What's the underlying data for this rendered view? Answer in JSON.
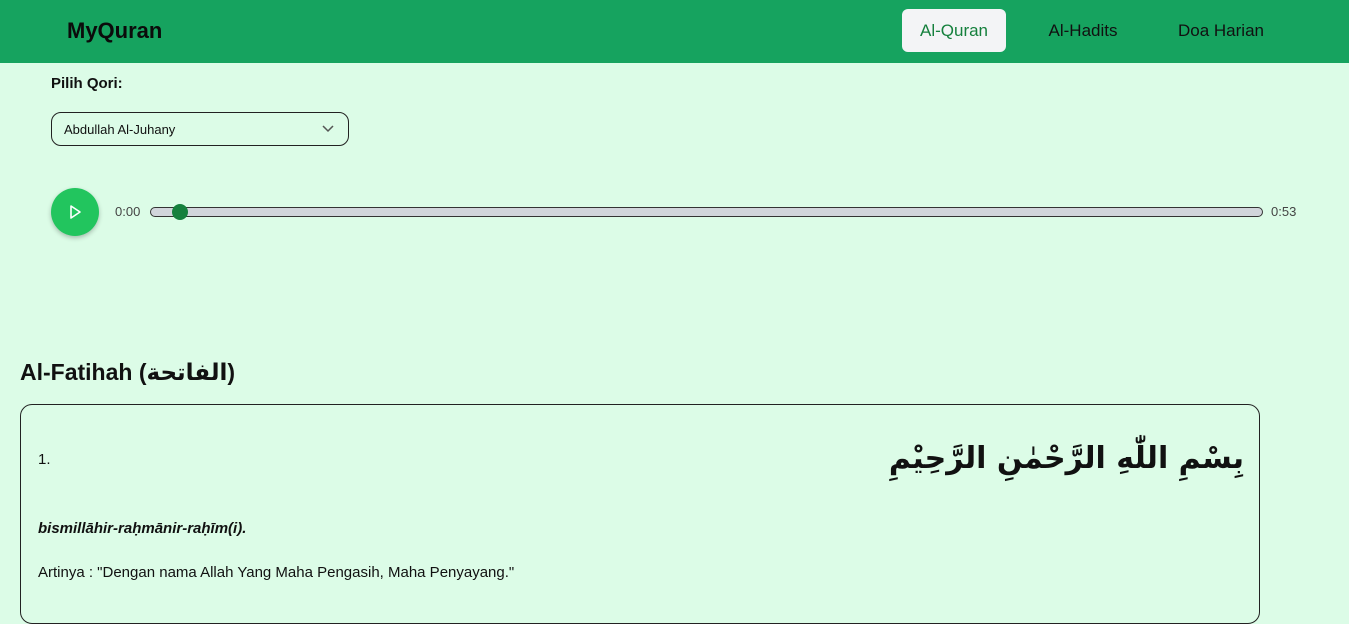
{
  "app": {
    "brand": "MyQuran"
  },
  "nav": {
    "items": [
      {
        "label": "Al-Quran",
        "active": true
      },
      {
        "label": "Al-Hadits",
        "active": false
      },
      {
        "label": "Doa Harian",
        "active": false
      }
    ]
  },
  "qori": {
    "label": "Pilih Qori:",
    "selected": "Abdullah Al-Juhany"
  },
  "player": {
    "current_time": "0:00",
    "duration": "0:53",
    "progress": 0.02,
    "play_icon": "play-icon"
  },
  "surah": {
    "title": "Al-Fatihah (الفاتحة)"
  },
  "ayahs": [
    {
      "number": "1.",
      "arabic": "بِسْمِ اللّٰهِ الرَّحْمٰنِ الرَّحِيْمِ",
      "latin": "bismillāhir-raḥmānir-raḥīm(i).",
      "meaning": "Artinya : \"Dengan nama Allah Yang Maha Pengasih, Maha Penyayang.\""
    }
  ],
  "colors": {
    "navbar": "#16a35f",
    "background": "#dcfce7",
    "accent": "#22c55e",
    "active_nav_text": "#15803d"
  }
}
